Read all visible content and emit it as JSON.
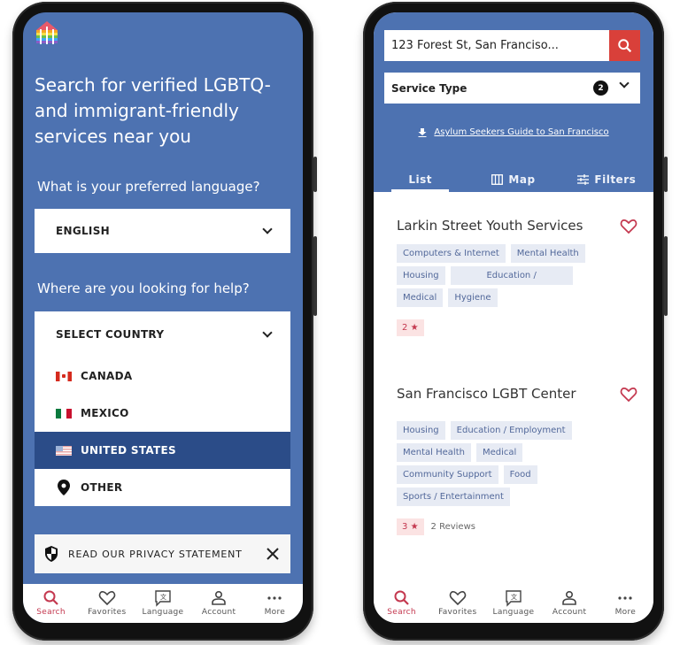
{
  "left_screen": {
    "hero_title": "Search for verified LGBTQ- and immigrant-friendly services near you",
    "language_question": "What is your preferred language?",
    "language_selected": "ENGLISH",
    "location_question": "Where are you looking for help?",
    "country_placeholder": "SELECT COUNTRY",
    "countries": [
      {
        "label": "CANADA",
        "icon": "flag-canada",
        "selected": false
      },
      {
        "label": "MEXICO",
        "icon": "flag-mexico",
        "selected": false
      },
      {
        "label": "UNITED STATES",
        "icon": "flag-united-states",
        "selected": true
      },
      {
        "label": "OTHER",
        "icon": "map-pin-icon",
        "selected": false
      }
    ],
    "privacy_banner": "READ OUR PRIVACY STATEMENT"
  },
  "right_screen": {
    "search_value": "123 Forest St, San Franciso...",
    "service_type_label": "Service Type",
    "service_type_count": "2",
    "guide_link": "Asylum Seekers Guide to San Francisco",
    "tabs": [
      {
        "label": "List",
        "icon": "",
        "active": true
      },
      {
        "label": "Map",
        "icon": "map-icon",
        "active": false
      },
      {
        "label": "Filters",
        "icon": "sliders-icon",
        "active": false
      }
    ],
    "results": [
      {
        "name": "Larkin Street Youth Services",
        "tags": [
          "Computers & Internet",
          "Mental Health",
          "Housing",
          "Education /",
          "Medical",
          "Hygiene"
        ],
        "rating": "2",
        "reviews": ""
      },
      {
        "name": "San Francisco LGBT Center",
        "tags": [
          "Housing",
          "Education / Employment",
          "Mental Health",
          "Medical",
          "Community Support",
          "Food",
          "Sports / Entertainment"
        ],
        "rating": "3",
        "reviews": "2 Reviews"
      }
    ]
  },
  "bottom_nav": [
    {
      "label": "Search",
      "icon": "search-icon",
      "active": true
    },
    {
      "label": "Favorites",
      "icon": "heart-icon",
      "active": false
    },
    {
      "label": "Language",
      "icon": "language-icon",
      "active": false
    },
    {
      "label": "Account",
      "icon": "account-icon",
      "active": false
    },
    {
      "label": "More",
      "icon": "more-icon",
      "active": false
    }
  ],
  "colors": {
    "brand_blue": "#4d72b1",
    "selected_blue": "#2b4c88",
    "accent_red": "#d9403a",
    "active_nav": "#c4384f",
    "tag_bg": "#e7ebf4"
  }
}
